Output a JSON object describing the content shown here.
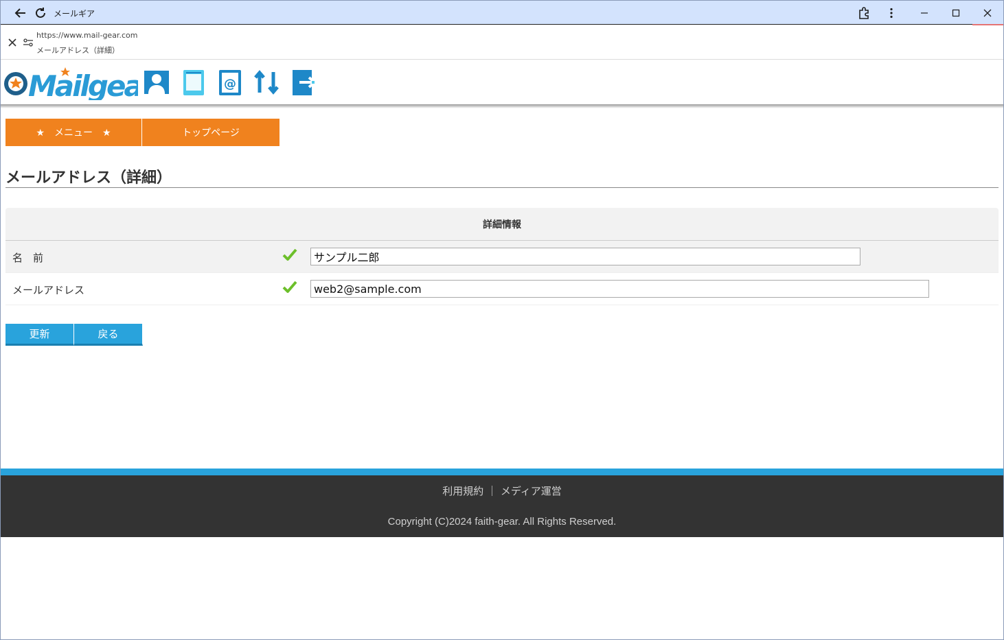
{
  "window": {
    "title": "メールギア"
  },
  "address": {
    "url": "https://www.mail-gear.com",
    "page_title": "メールアドレス（詳細）"
  },
  "nav": {
    "menu_label": "★　メニュー　★",
    "top_label": "トップページ"
  },
  "page": {
    "heading": "メールアドレス（詳細）"
  },
  "detail": {
    "header": "詳細情報",
    "rows": [
      {
        "label": "名　前",
        "value": "サンプル二郎"
      },
      {
        "label": "メールアドレス",
        "value": "web2@sample.com"
      }
    ]
  },
  "buttons": {
    "update": "更新",
    "back": "戻る"
  },
  "footer": {
    "terms": "利用規約",
    "separator": "｜",
    "media": "メディア運営",
    "copyright": "Copyright (C)2024 faith-gear. All Rights Reserved."
  },
  "colors": {
    "nav_orange": "#f0821e",
    "button_blue": "#29a3dc",
    "footer_dark": "#333333",
    "check_green": "#6cbf2a"
  }
}
